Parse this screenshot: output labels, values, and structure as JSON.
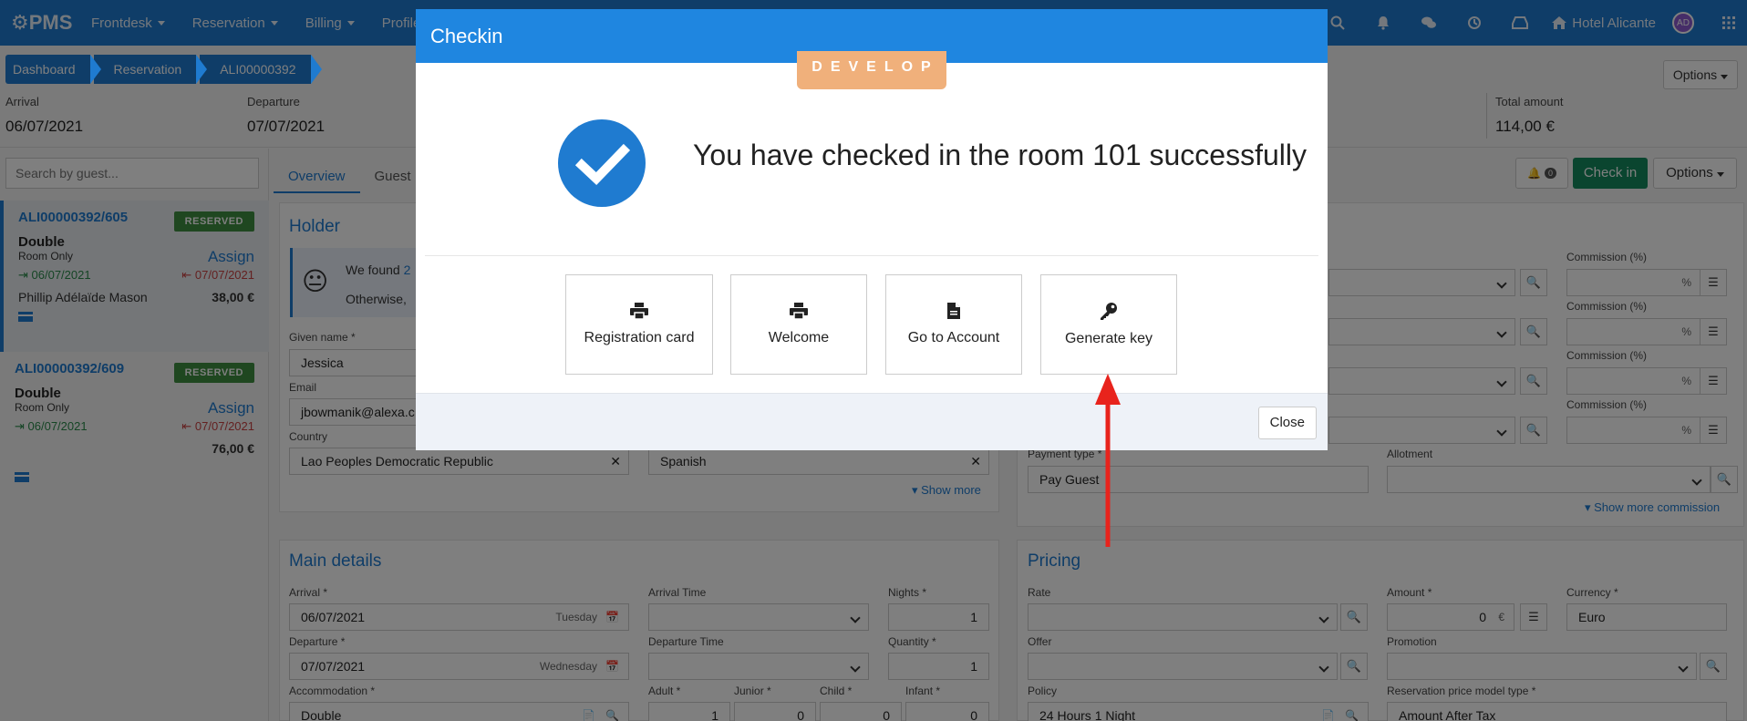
{
  "app": {
    "logo": "PMS"
  },
  "navbar": {
    "items": [
      {
        "label": "Frontdesk"
      },
      {
        "label": "Reservation"
      },
      {
        "label": "Billing"
      },
      {
        "label": "Profile"
      }
    ],
    "hotel": "Hotel Alicante",
    "avatar_initials": "AD"
  },
  "breadcrumb": [
    "Dashboard",
    "Reservation",
    "ALI00000392"
  ],
  "top_options": "Options",
  "summary": {
    "arrival_label": "Arrival",
    "arrival_value": "06/07/2021",
    "departure_label": "Departure",
    "departure_value": "07/07/2021",
    "total_label": "Total amount",
    "total_value": "114,00 €"
  },
  "sidebar": {
    "search_placeholder": "Search by guest...",
    "reservations": [
      {
        "code": "ALI00000392/605",
        "status": "RESERVED",
        "room_type": "Double",
        "board": "Room Only",
        "assign": "Assign",
        "arrival": "06/07/2021",
        "departure": "07/07/2021",
        "guest": "Phillip Adélaïde Mason",
        "price": "38,00 €"
      },
      {
        "code": "ALI00000392/609",
        "status": "RESERVED",
        "room_type": "Double",
        "board": "Room Only",
        "assign": "Assign",
        "arrival": "06/07/2021",
        "departure": "07/07/2021",
        "guest": "",
        "price": "76,00 €"
      }
    ]
  },
  "tabs": [
    "Overview",
    "Guest"
  ],
  "toolbar": {
    "bell_count": "0",
    "checkin": "Check in",
    "options": "Options"
  },
  "holder": {
    "title": "Holder",
    "notice_line1": "We found",
    "notice_count": "2",
    "notice_line2": "Otherwise,",
    "given_name_label": "Given name *",
    "given_name": "Jessica",
    "email_label": "Email",
    "email": "jbowmanik@alexa.c",
    "country_label": "Country",
    "country": "Lao Peoples Democratic Republic",
    "language": "Spanish",
    "show_more": "Show more"
  },
  "commission": {
    "label": "Commission (%)",
    "suffix": "%",
    "payment_type_label": "Payment type *",
    "payment_type": "Pay Guest",
    "allotment_label": "Allotment",
    "show_more_commission": "Show more commission"
  },
  "main_details": {
    "title": "Main details",
    "arrival_label": "Arrival *",
    "arrival": "06/07/2021",
    "arrival_day": "Tuesday",
    "arrival_time_label": "Arrival Time",
    "nights_label": "Nights *",
    "nights": "1",
    "departure_label": "Departure *",
    "departure": "07/07/2021",
    "departure_day": "Wednesday",
    "departure_time_label": "Departure Time",
    "quantity_label": "Quantity *",
    "quantity": "1",
    "accommodation_label": "Accommodation *",
    "accommodation": "Double",
    "adult_label": "Adult *",
    "adult": "1",
    "junior_label": "Junior *",
    "junior": "0",
    "child_label": "Child *",
    "child": "0",
    "infant_label": "Infant *",
    "infant": "0"
  },
  "pricing": {
    "title": "Pricing",
    "rate_label": "Rate",
    "amount_label": "Amount *",
    "amount": "0",
    "amount_suffix": "€",
    "currency_label": "Currency *",
    "currency": "Euro",
    "offer_label": "Offer",
    "promotion_label": "Promotion",
    "policy_label": "Policy",
    "policy": "24 Hours 1 Night",
    "price_model_label": "Reservation price model type *",
    "price_model": "Amount After Tax"
  },
  "modal": {
    "title": "Checkin",
    "env_badge": "DEVELOP",
    "message": "You have checked in the room 101 successfully",
    "actions": [
      {
        "label": "Registration card",
        "icon": "printer-icon"
      },
      {
        "label": "Welcome",
        "icon": "printer-icon"
      },
      {
        "label": "Go to Account",
        "icon": "document-icon"
      },
      {
        "label": "Generate key",
        "icon": "key-icon"
      }
    ],
    "close": "Close"
  },
  "colors": {
    "primary": "#1f7bd0",
    "header": "#1f86e0",
    "success": "#158a5e",
    "reserved": "#3e8e41",
    "develop": "#f0b07b",
    "annotation_arrow": "#e8231c"
  }
}
